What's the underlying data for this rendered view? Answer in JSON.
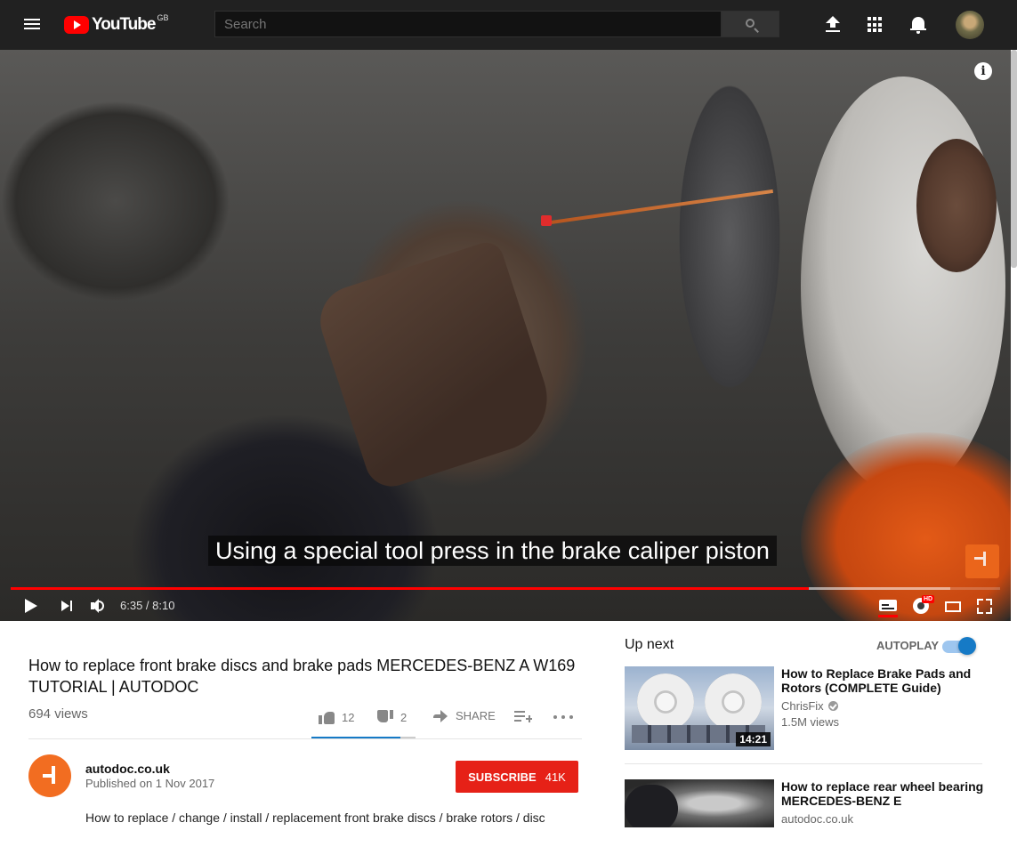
{
  "masthead": {
    "logo_text": "YouTube",
    "region": "GB",
    "search_placeholder": "Search"
  },
  "player": {
    "caption": "Using a special tool press in the brake caliper piston",
    "time_display": "6:35 / 8:10",
    "played_fraction": 0.807,
    "buffered_fraction": 0.95,
    "hd_badge": "HD"
  },
  "video": {
    "title": "How to replace front brake discs and brake pads MERCEDES-BENZ A W169 TUTORIAL | AUTODOC",
    "views": "694 views",
    "likes": "12",
    "dislikes": "2",
    "share_label": "SHARE",
    "like_ratio": 0.857
  },
  "owner": {
    "name": "autodoc.co.uk",
    "published": "Published on 1 Nov 2017",
    "subscribe_label": "SUBSCRIBE",
    "subscriber_count": "41K"
  },
  "description": "How to replace / change / install / replacement front brake discs / brake rotors / disc",
  "sidebar": {
    "up_next_label": "Up next",
    "autoplay_label": "AUTOPLAY",
    "autoplay_on": true,
    "recommendations": [
      {
        "title": "How to Replace Brake Pads and Rotors (COMPLETE Guide)",
        "channel": "ChrisFix",
        "verified": true,
        "views": "1.5M views",
        "duration": "14:21"
      },
      {
        "title": "How to replace rear wheel bearing MERCEDES-BENZ E",
        "channel": "autodoc.co.uk"
      }
    ]
  },
  "colors": {
    "masthead_bg": "#212121",
    "brand_red": "#ff0000",
    "subscribe_red": "#e62117",
    "accent_blue": "#167ac6",
    "autodoc_orange": "#f26d21"
  }
}
